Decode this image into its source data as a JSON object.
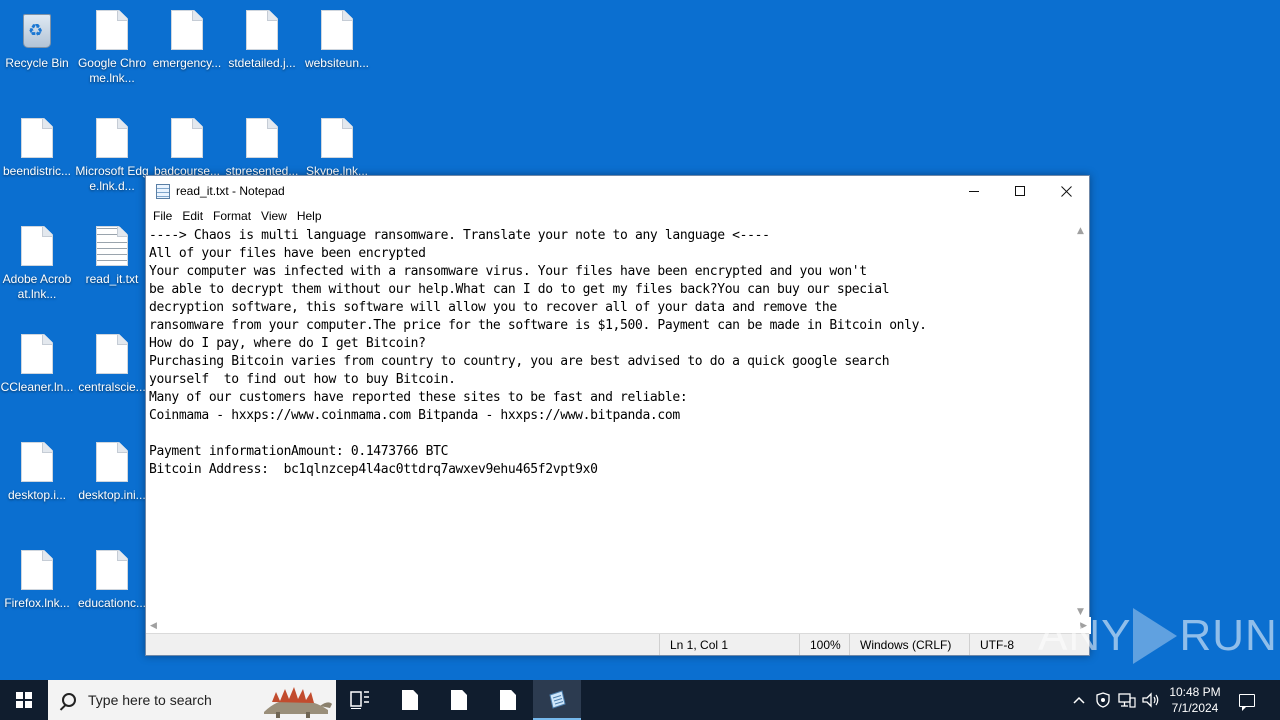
{
  "desktop": {
    "icons": [
      {
        "label": "Recycle Bin",
        "type": "recycle"
      },
      {
        "label": "Google Chrome.lnk...",
        "type": "file"
      },
      {
        "label": "emergency...",
        "type": "file"
      },
      {
        "label": "stdetailed.j...",
        "type": "file"
      },
      {
        "label": "websiteun...",
        "type": "file"
      },
      {
        "label": "beendistric...",
        "type": "file"
      },
      {
        "label": "Microsoft Edge.lnk.d...",
        "type": "file"
      },
      {
        "label": "badcourse...",
        "type": "file"
      },
      {
        "label": "stpresented...",
        "type": "file"
      },
      {
        "label": "Skype.lnk...",
        "type": "file"
      },
      {
        "label": "Adobe Acrobat.lnk...",
        "type": "file"
      },
      {
        "label": "read_it.txt",
        "type": "text"
      },
      {
        "label": "CCleaner.ln...",
        "type": "file"
      },
      {
        "label": "centralscie...",
        "type": "file"
      },
      {
        "label": "desktop.i...",
        "type": "file"
      },
      {
        "label": "desktop.ini...",
        "type": "file"
      },
      {
        "label": "Firefox.lnk...",
        "type": "file"
      },
      {
        "label": "educationc...",
        "type": "file"
      }
    ]
  },
  "notepad": {
    "title": "read_it.txt - Notepad",
    "menu": [
      "File",
      "Edit",
      "Format",
      "View",
      "Help"
    ],
    "content": "----> Chaos is multi language ransomware. Translate your note to any language <----\nAll of your files have been encrypted\nYour computer was infected with a ransomware virus. Your files have been encrypted and you won't\nbe able to decrypt them without our help.What can I do to get my files back?You can buy our special\ndecryption software, this software will allow you to recover all of your data and remove the\nransomware from your computer.The price for the software is $1,500. Payment can be made in Bitcoin only.\nHow do I pay, where do I get Bitcoin?\nPurchasing Bitcoin varies from country to country, you are best advised to do a quick google search\nyourself  to find out how to buy Bitcoin.\nMany of our customers have reported these sites to be fast and reliable:\nCoinmama - hxxps://www.coinmama.com Bitpanda - hxxps://www.bitpanda.com\n\nPayment informationAmount: 0.1473766 BTC\nBitcoin Address:  bc1qlnzcep4l4ac0ttdrq7awxev9ehu465f2vpt9x0",
    "status": {
      "position": "Ln 1, Col 1",
      "zoom": "100%",
      "line_ending": "Windows (CRLF)",
      "encoding": "UTF-8"
    },
    "caption_icons": [
      "minimize-icon",
      "maximize-icon",
      "close-icon"
    ]
  },
  "watermark": {
    "left": "ANY",
    "right": "RUN"
  },
  "taskbar": {
    "search_placeholder": "Type here to search",
    "time": "10:48 PM",
    "date": "7/1/2024"
  },
  "colors": {
    "desktop_bg": "#0b6fd0",
    "taskbar_bg": "#101d2e",
    "accent": "#76b9ed"
  }
}
